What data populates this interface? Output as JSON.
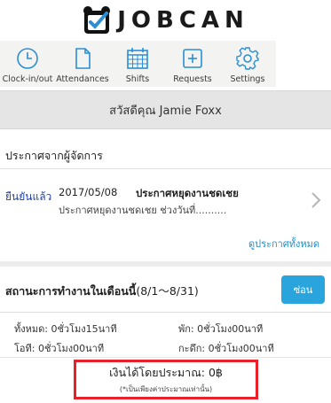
{
  "brand": {
    "name": "JOBCAN"
  },
  "nav": {
    "items": [
      {
        "label": "Clock-in/out",
        "icon": "clock-icon"
      },
      {
        "label": "Attendances",
        "icon": "document-icon"
      },
      {
        "label": "Shifts",
        "icon": "calendar-icon"
      },
      {
        "label": "Requests",
        "icon": "plus-square-icon"
      },
      {
        "label": "Settings",
        "icon": "gear-icon"
      }
    ]
  },
  "greeting": "สวัสดีคุณ Jamie Foxx",
  "notices": {
    "title": "ประกาศจากผู้จัดการ",
    "items": [
      {
        "status": "ยืนยันแล้ว",
        "date": "2017/05/08",
        "subject": "ประกาศหยุดงานชดเชย",
        "preview": "ประกาศหยุดงานชดเชย ช่วงวันที่.........."
      }
    ],
    "view_all": "ดูประกาศทั้งหมด"
  },
  "status": {
    "title": "สถานะการทำงานในเดือนนี้",
    "period": "(8/1〜8/31)",
    "hide_button": "ซ่อน",
    "stats": {
      "total": "ทั้งหมด: 0ชั่วโมง15นาที",
      "break": "พัก: 0ชั่วโมง00นาที",
      "overtime": "โอที: 0ชั่วโมง00นาที",
      "late_night": "กะดึก: 0ชั่วโมง00นาที"
    },
    "estimated_pay": "เงินได้โดยประมาณ: 0฿",
    "estimate_note": "(*เป็นเพียงค่าประมาณเท่านั้น)"
  },
  "colors": {
    "accent_blue": "#2aa4dc",
    "link_blue": "#1f8fd0",
    "confirmed_blue": "#1e3fa8",
    "highlight_red": "#e8202a",
    "nav_icon": "#2a8fd4"
  }
}
